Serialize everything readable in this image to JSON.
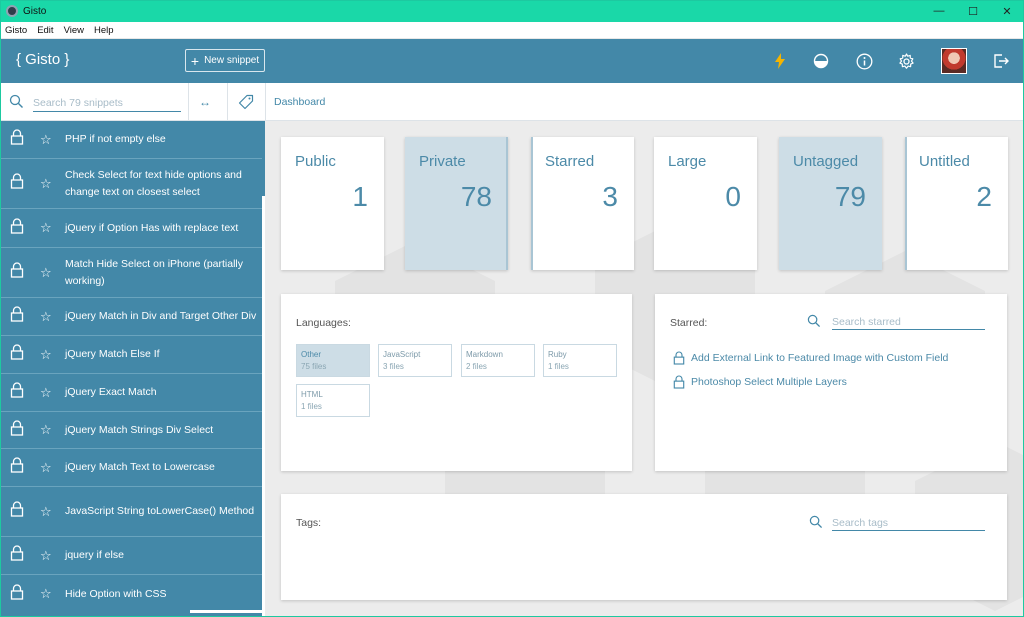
{
  "window": {
    "title": "Gisto",
    "controls": [
      "—",
      "☐",
      "✕"
    ]
  },
  "menu": [
    "Gisto",
    "Edit",
    "View",
    "Help"
  ],
  "appbar": {
    "brand": "{ Gisto }",
    "new_snippet_label": "New snippet",
    "icons": [
      "lightning-icon",
      "theme-icon",
      "info-icon",
      "settings-icon",
      "avatar",
      "logout-icon"
    ],
    "accent_color": "#4388a8",
    "lightning_color": "#f5b400"
  },
  "search": {
    "placeholder": "Search 79 snippets"
  },
  "breadcrumb": "Dashboard",
  "snippets": [
    {
      "title": "PHP if not empty else"
    },
    {
      "title": "Check Select for text hide options and change text on closest select"
    },
    {
      "title": "jQuery if Option Has with replace text"
    },
    {
      "title": "Match Hide Select on iPhone (partially working)"
    },
    {
      "title": "jQuery Match in Div and Target Other Div"
    },
    {
      "title": "jQuery Match Else If"
    },
    {
      "title": "jQuery Exact Match"
    },
    {
      "title": "jQuery Match Strings Div Select"
    },
    {
      "title": "jQuery Match Text to Lowercase"
    },
    {
      "title": "JavaScript String toLowerCase() Method"
    },
    {
      "title": "jquery if else"
    },
    {
      "title": "Hide Option with CSS"
    }
  ],
  "stats": [
    {
      "label": "Public",
      "value": "1",
      "highlighted": false
    },
    {
      "label": "Private",
      "value": "78",
      "highlighted": true
    },
    {
      "label": "Starred",
      "value": "3",
      "highlighted": false
    },
    {
      "label": "Large",
      "value": "0",
      "highlighted": false
    },
    {
      "label": "Untagged",
      "value": "79",
      "highlighted": true
    },
    {
      "label": "Untitled",
      "value": "2",
      "highlighted": false
    }
  ],
  "languages": {
    "title": "Languages:",
    "items": [
      {
        "name": "Other",
        "files": "75 files"
      },
      {
        "name": "JavaScript",
        "files": "3 files"
      },
      {
        "name": "Markdown",
        "files": "2 files"
      },
      {
        "name": "Ruby",
        "files": "1 files"
      },
      {
        "name": "HTML",
        "files": "1 files"
      }
    ]
  },
  "starred": {
    "title": "Starred:",
    "search_placeholder": "Search starred",
    "items": [
      {
        "title": "Add External Link to Featured Image with Custom Field"
      },
      {
        "title": "Photoshop Select Multiple Layers"
      }
    ]
  },
  "tags": {
    "title": "Tags:",
    "search_placeholder": "Search tags"
  }
}
